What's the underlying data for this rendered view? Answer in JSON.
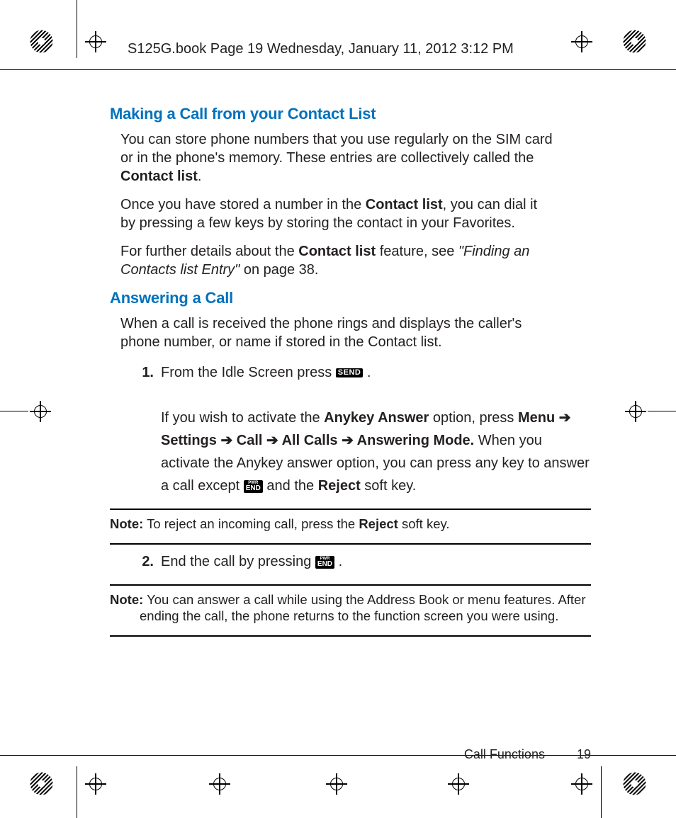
{
  "header": "S125G.book  Page 19  Wednesday, January 11, 2012  3:12 PM",
  "s1": {
    "title": "Making a Call from your Contact List",
    "p1a": "You can store phone numbers that you use regularly on the SIM card or in the phone's memory. These entries are collectively called the ",
    "p1b": "Contact list",
    "p1c": ".",
    "p2a": "Once you have stored a number in the ",
    "p2b": "Contact list",
    "p2c": ", you can dial it by pressing a few keys by storing the contact in your Favorites.",
    "p3a": "For further details about the ",
    "p3b": "Contact list",
    "p3c": " feature, see ",
    "p3d": "\"Finding an Contacts list Entry\"",
    "p3e": " on page 38."
  },
  "s2": {
    "title": "Answering a Call",
    "p1": "When a call is received the phone rings and displays the caller's phone number, or name if stored in the Contact list.",
    "steps": {
      "n1": "1.",
      "n2": "2.",
      "s1a": "From the Idle Screen press ",
      "s1b": ".",
      "s1c": "If you wish to activate the ",
      "s1d": "Anykey Answer",
      "s1e": " option, press ",
      "s1f": "Menu",
      "arrow": " ➔ ",
      "s1g": "Settings",
      "s1h": "Call",
      "s1i": "All Calls",
      "s1j": "Answering Mode.",
      "s1k": " When you activate the Anykey answer option, you can press any key to answer a call except ",
      "s1l": " and the ",
      "s1m": "Reject",
      "s1n": " soft key.",
      "s2a": "End the call by pressing ",
      "s2b": "."
    },
    "note1a": "Note:",
    "note1b": " To reject an incoming call, press the ",
    "note1c": "Reject",
    "note1d": " soft key.",
    "note2a": "Note:",
    "note2b": " You can answer a call while using the Address Book or menu features. After ending the call, the phone returns to the function screen you were using."
  },
  "keys": {
    "send": "SEND",
    "end_top": "PWR",
    "end_bot": "END"
  },
  "footer": {
    "section": "Call Functions",
    "page": "19"
  }
}
